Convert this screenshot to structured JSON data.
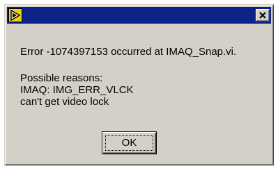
{
  "dialog": {
    "error_line": "Error -1074397153 occurred at IMAQ_Snap.vi.",
    "reasons_heading": "Possible reasons:",
    "reason_code": "IMAQ:  IMG_ERR_VLCK",
    "reason_description": "can't get video lock",
    "ok_label": "OK"
  },
  "titlebar": {
    "icon": "labview-run-arrow-icon",
    "close_icon": "close-icon",
    "color": "#0c2388"
  }
}
